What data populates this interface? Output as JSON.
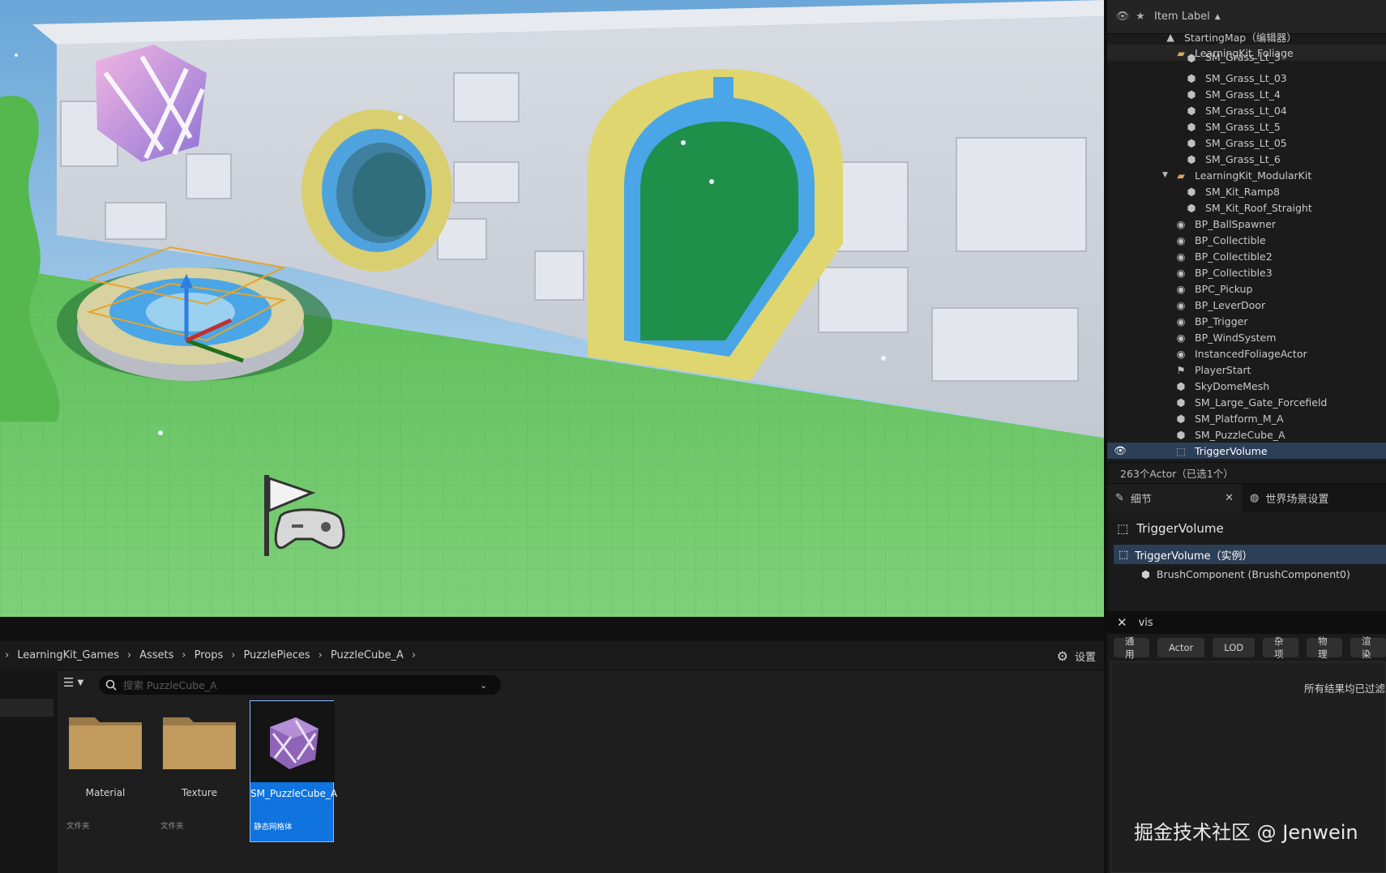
{
  "outliner": {
    "header_label": "Item Label",
    "sort_indicator": "▲",
    "rows": [
      {
        "label": "StartingMap（编辑器）",
        "icon": "map-icon"
      },
      {
        "label": "LearningKit_Foliage",
        "icon": "folder-icon"
      },
      {
        "label": "SM_Grass_Lt_3",
        "icon": "static-mesh-icon"
      },
      {
        "label": "SM_Grass_Lt_03",
        "icon": "static-mesh-icon"
      },
      {
        "label": "SM_Grass_Lt_4",
        "icon": "static-mesh-icon"
      },
      {
        "label": "SM_Grass_Lt_04",
        "icon": "static-mesh-icon"
      },
      {
        "label": "SM_Grass_Lt_5",
        "icon": "static-mesh-icon"
      },
      {
        "label": "SM_Grass_Lt_05",
        "icon": "static-mesh-icon"
      },
      {
        "label": "SM_Grass_Lt_6",
        "icon": "static-mesh-icon"
      },
      {
        "label": "LearningKit_ModularKit",
        "icon": "folder-icon"
      },
      {
        "label": "SM_Kit_Ramp8",
        "icon": "static-mesh-icon"
      },
      {
        "label": "SM_Kit_Roof_Straight",
        "icon": "static-mesh-icon"
      },
      {
        "label": "BP_BallSpawner",
        "icon": "blueprint-actor-icon"
      },
      {
        "label": "BP_Collectible",
        "icon": "blueprint-actor-icon"
      },
      {
        "label": "BP_Collectible2",
        "icon": "blueprint-actor-icon"
      },
      {
        "label": "BP_Collectible3",
        "icon": "blueprint-actor-icon"
      },
      {
        "label": "BPC_Pickup",
        "icon": "blueprint-actor-icon"
      },
      {
        "label": "BP_LeverDoor",
        "icon": "blueprint-actor-icon"
      },
      {
        "label": "BP_Trigger",
        "icon": "blueprint-actor-icon"
      },
      {
        "label": "BP_WindSystem",
        "icon": "blueprint-actor-icon"
      },
      {
        "label": "InstancedFoliageActor",
        "icon": "blueprint-actor-icon"
      },
      {
        "label": "PlayerStart",
        "icon": "player-start-icon"
      },
      {
        "label": "SkyDomeMesh",
        "icon": "static-mesh-icon"
      },
      {
        "label": "SM_Large_Gate_Forcefield",
        "icon": "static-mesh-icon"
      },
      {
        "label": "SM_Platform_M_A",
        "icon": "static-mesh-icon"
      },
      {
        "label": "SM_PuzzleCube_A",
        "icon": "static-mesh-icon"
      },
      {
        "label": "TriggerVolume",
        "icon": "trigger-volume-icon"
      }
    ],
    "footer": "263个Actor（已选1个）"
  },
  "details": {
    "tab_details": "细节",
    "tab_world": "世界场景设置",
    "object_name": "TriggerVolume",
    "instance_row": "TriggerVolume（实例）",
    "component_row": "BrushComponent (BrushComponent0)",
    "search_value": "vis",
    "filter_tabs": [
      "通用",
      "Actor",
      "LOD",
      "杂项",
      "物理",
      "渲染"
    ],
    "results_text": "所有结果均已过滤",
    "watermark": "掘金技术社区 @ Jenwein"
  },
  "content_browser": {
    "breadcrumb": [
      "LearningKit_Games",
      "Assets",
      "Props",
      "PuzzlePieces",
      "PuzzleCube_A"
    ],
    "settings_label": "设置",
    "search_placeholder": "搜索 PuzzleCube_A",
    "assets": [
      {
        "name": "Material",
        "type": "文件夹"
      },
      {
        "name": "Texture",
        "type": "文件夹"
      },
      {
        "name": "SM_PuzzleCube_A",
        "type": "静态网格体"
      }
    ]
  },
  "colors": {
    "selection": "#2b3f57",
    "asset_selected": "#0f73e0",
    "panel": "#1b1b1b"
  }
}
